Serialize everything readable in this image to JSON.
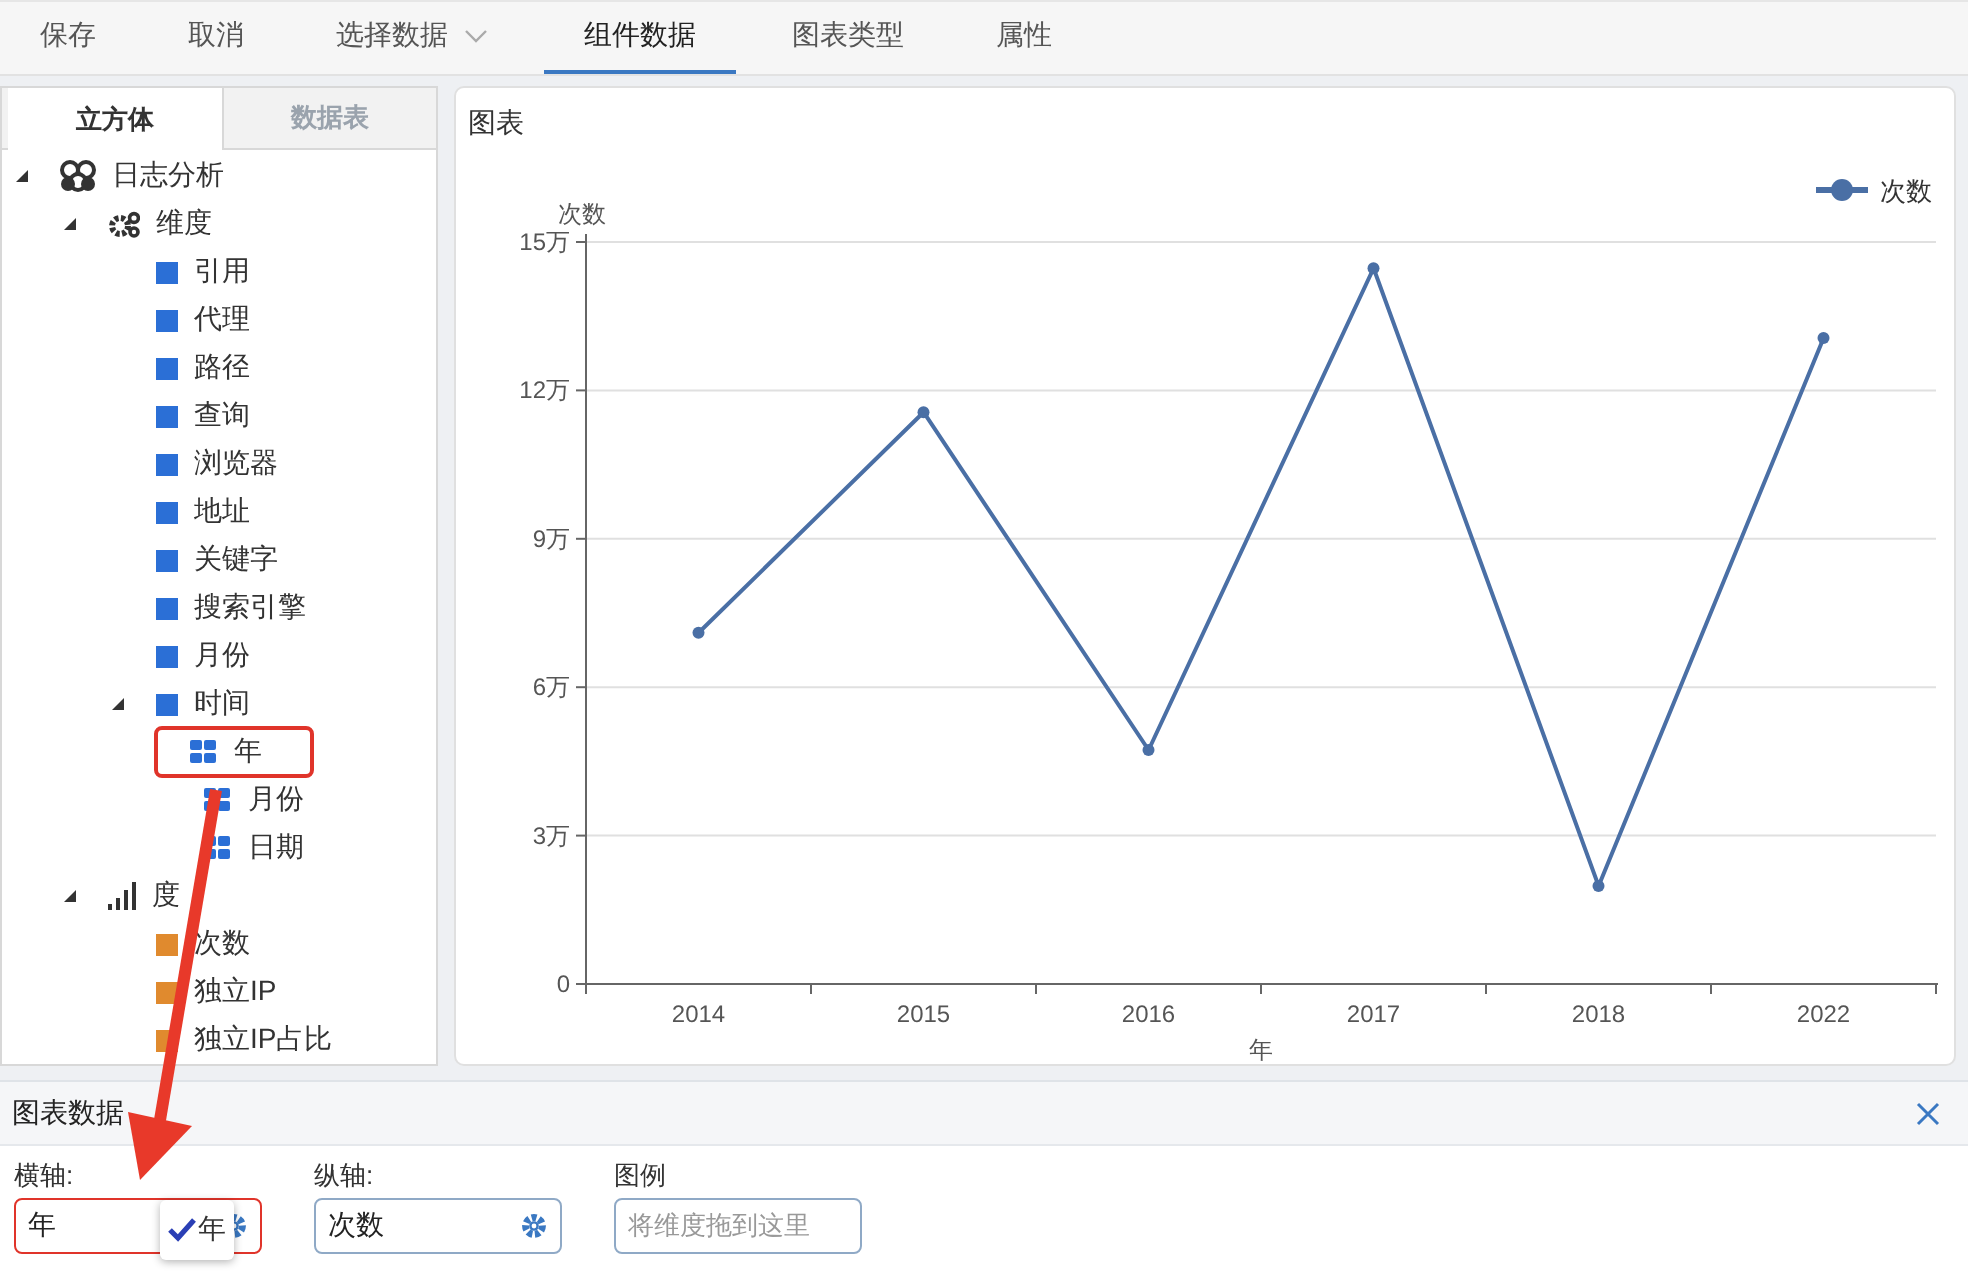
{
  "toolbar": {
    "items": [
      {
        "label": "保存",
        "selected": false,
        "dropdown": false
      },
      {
        "label": "取消",
        "selected": false,
        "dropdown": false
      },
      {
        "label": "选择数据",
        "selected": false,
        "dropdown": true
      },
      {
        "label": "组件数据",
        "selected": true,
        "dropdown": false
      },
      {
        "label": "图表类型",
        "selected": false,
        "dropdown": false
      },
      {
        "label": "属性",
        "selected": false,
        "dropdown": false
      }
    ]
  },
  "sidebar": {
    "tabs": [
      {
        "label": "立方体",
        "selected": true
      },
      {
        "label": "数据表",
        "selected": false
      }
    ],
    "tree": [
      {
        "label": "日志分析",
        "kind": "cube",
        "expanded": true,
        "children": [
          {
            "label": "维度",
            "kind": "dimensions",
            "expanded": true,
            "children": [
              {
                "label": "引用",
                "kind": "dimension"
              },
              {
                "label": "代理",
                "kind": "dimension"
              },
              {
                "label": "路径",
                "kind": "dimension"
              },
              {
                "label": "查询",
                "kind": "dimension"
              },
              {
                "label": "浏览器",
                "kind": "dimension"
              },
              {
                "label": "地址",
                "kind": "dimension"
              },
              {
                "label": "关键字",
                "kind": "dimension"
              },
              {
                "label": "搜索引擎",
                "kind": "dimension"
              },
              {
                "label": "月份",
                "kind": "dimension"
              },
              {
                "label": "时间",
                "kind": "dimension",
                "expanded": true,
                "children": [
                  {
                    "label": "年",
                    "kind": "level",
                    "highlighted": true
                  },
                  {
                    "label": "月份",
                    "kind": "level",
                    "highlighted": false
                  },
                  {
                    "label": "日期",
                    "kind": "level",
                    "highlighted": false
                  }
                ]
              }
            ]
          },
          {
            "label": "度",
            "kind": "measures",
            "expanded": true,
            "children": [
              {
                "label": "次数",
                "kind": "measure"
              },
              {
                "label": "独立IP",
                "kind": "measure"
              },
              {
                "label": "独立IP占比",
                "kind": "measure"
              }
            ]
          }
        ]
      }
    ]
  },
  "chart_panel": {
    "title": "图表",
    "chart_data": {
      "type": "line",
      "xlabel": "年",
      "ylabel": "次数",
      "categories": [
        "2014",
        "2015",
        "2016",
        "2017",
        "2018",
        "2022"
      ],
      "grid": true,
      "series": [
        {
          "name": "次数",
          "color": "#4a6fa5",
          "marker": true,
          "values": [
            7.1,
            11.56,
            4.73,
            14.47,
            1.98,
            13.06
          ]
        }
      ],
      "ylim": [
        0,
        15
      ],
      "yticks": [
        {
          "value": 0,
          "label": "0"
        },
        {
          "value": 3,
          "label": "3万"
        },
        {
          "value": 6,
          "label": "6万"
        },
        {
          "value": 9,
          "label": "9万"
        },
        {
          "value": 12,
          "label": "12万"
        },
        {
          "value": 15,
          "label": "15万"
        }
      ]
    }
  },
  "data_panel": {
    "title": "图表数据",
    "fields": [
      {
        "label": "横轴:",
        "value": "年",
        "settings": true,
        "highlighted": true
      },
      {
        "label": "纵轴:",
        "value": "次数",
        "settings": true,
        "highlighted": false
      },
      {
        "label": "图例",
        "placeholder": "将维度拖到这里",
        "settings": false,
        "highlighted": false
      }
    ],
    "drag_ghost": "年"
  }
}
